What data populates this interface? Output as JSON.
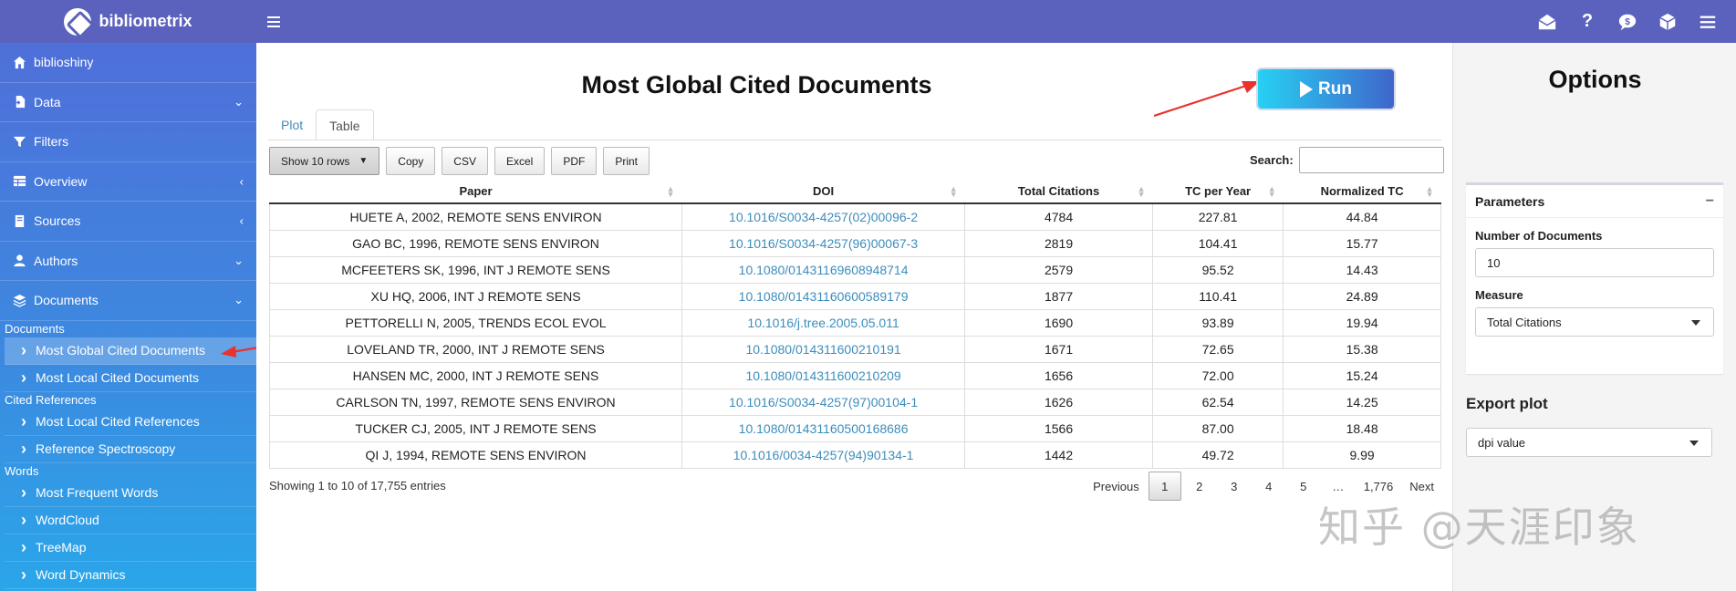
{
  "app": {
    "brand": "bibliometrix"
  },
  "sidebar": {
    "items": [
      {
        "label": "biblioshiny",
        "icon": "home-icon",
        "caret": ""
      },
      {
        "label": "Data",
        "icon": "file-import-icon",
        "caret": "⌄"
      },
      {
        "label": "Filters",
        "icon": "filter-icon",
        "caret": ""
      },
      {
        "label": "Overview",
        "icon": "table-icon",
        "caret": "‹"
      },
      {
        "label": "Sources",
        "icon": "book-icon",
        "caret": "‹"
      },
      {
        "label": "Authors",
        "icon": "user-icon",
        "caret": "⌄"
      },
      {
        "label": "Documents",
        "icon": "layers-icon",
        "caret": "⌄"
      }
    ],
    "sections": [
      {
        "label": "Documents",
        "items": [
          "Most Global Cited Documents",
          "Most Local Cited Documents"
        ]
      },
      {
        "label": "Cited References",
        "items": [
          "Most Local Cited References",
          "Reference Spectroscopy"
        ]
      },
      {
        "label": "Words",
        "items": [
          "Most Frequent Words",
          "WordCloud",
          "TreeMap",
          "Word Dynamics"
        ]
      }
    ]
  },
  "main": {
    "title": "Most Global Cited Documents",
    "run_label": "Run",
    "tabs": [
      {
        "label": "Plot"
      },
      {
        "label": "Table"
      }
    ],
    "buttons": {
      "show_rows": "Show 10 rows",
      "copy": "Copy",
      "csv": "CSV",
      "excel": "Excel",
      "pdf": "PDF",
      "print": "Print"
    },
    "search_label": "Search:",
    "table": {
      "columns": [
        "Paper",
        "DOI",
        "Total Citations",
        "TC per Year",
        "Normalized TC"
      ],
      "rows": [
        [
          "HUETE A, 2002, REMOTE SENS ENVIRON",
          "10.1016/S0034-4257(02)00096-2",
          "4784",
          "227.81",
          "44.84"
        ],
        [
          "GAO BC, 1996, REMOTE SENS ENVIRON",
          "10.1016/S0034-4257(96)00067-3",
          "2819",
          "104.41",
          "15.77"
        ],
        [
          "MCFEETERS SK, 1996, INT J REMOTE SENS",
          "10.1080/01431169608948714",
          "2579",
          "95.52",
          "14.43"
        ],
        [
          "XU HQ, 2006, INT J REMOTE SENS",
          "10.1080/01431160600589179",
          "1877",
          "110.41",
          "24.89"
        ],
        [
          "PETTORELLI N, 2005, TRENDS ECOL EVOL",
          "10.1016/j.tree.2005.05.011",
          "1690",
          "93.89",
          "19.94"
        ],
        [
          "LOVELAND TR, 2000, INT J REMOTE SENS",
          "10.1080/014311600210191",
          "1671",
          "72.65",
          "15.38"
        ],
        [
          "HANSEN MC, 2000, INT J REMOTE SENS",
          "10.1080/014311600210209",
          "1656",
          "72.00",
          "15.24"
        ],
        [
          "CARLSON TN, 1997, REMOTE SENS ENVIRON",
          "10.1016/S0034-4257(97)00104-1",
          "1626",
          "62.54",
          "14.25"
        ],
        [
          "TUCKER CJ, 2005, INT J REMOTE SENS",
          "10.1080/01431160500168686",
          "1566",
          "87.00",
          "18.48"
        ],
        [
          "QI J, 1994, REMOTE SENS ENVIRON",
          "10.1016/0034-4257(94)90134-1",
          "1442",
          "49.72",
          "9.99"
        ]
      ]
    },
    "info": "Showing 1 to 10 of 17,755 entries",
    "pagination": {
      "previous": "Previous",
      "pages": [
        "1",
        "2",
        "3",
        "4",
        "5",
        "…",
        "1,776"
      ],
      "current": "1",
      "next": "Next"
    }
  },
  "options": {
    "title": "Options",
    "parameters_title": "Parameters",
    "num_docs_label": "Number of Documents",
    "num_docs_value": "10",
    "measure_label": "Measure",
    "measure_value": "Total Citations",
    "export_title": "Export plot",
    "export_value": "dpi value"
  },
  "watermark": "知乎 @天涯印象",
  "colors": {
    "topbar": "#5b62bd",
    "link": "#3c8dbc",
    "arrow": "#e8322b"
  }
}
